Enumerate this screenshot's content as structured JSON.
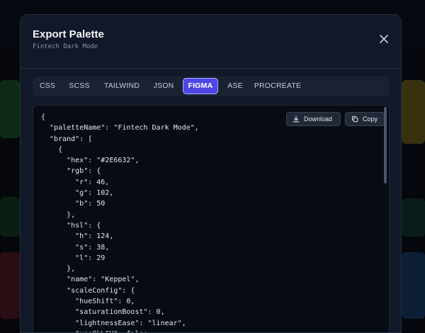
{
  "modal": {
    "title": "Export Palette",
    "subtitle": "Fintech Dark Mode"
  },
  "tabs": [
    {
      "label": "CSS",
      "active": false
    },
    {
      "label": "SCSS",
      "active": false
    },
    {
      "label": "TAILWIND",
      "active": false
    },
    {
      "label": "JSON",
      "active": false
    },
    {
      "label": "FIGMA",
      "active": true
    },
    {
      "label": "ASE",
      "active": false
    },
    {
      "label": "PROCREATE",
      "active": false
    }
  ],
  "actions": {
    "download_label": "Download",
    "copy_label": "Copy"
  },
  "code": {
    "lines": [
      "{",
      "  \"paletteName\": \"Fintech Dark Mode\",",
      "  \"brand\": [",
      "    {",
      "      \"hex\": \"#2E6632\",",
      "      \"rgb\": {",
      "        \"r\": 46,",
      "        \"g\": 102,",
      "        \"b\": 50",
      "      },",
      "      \"hsl\": {",
      "        \"h\": 124,",
      "        \"s\": 38,",
      "        \"l\": 29",
      "      },",
      "      \"name\": \"Keppel\",",
      "      \"scaleConfig\": {",
      "        \"hueShift\": 0,",
      "        \"saturationBoost\": 0,",
      "        \"lightnessEase\": \"linear\",",
      "        \"useOkLCH\": false"
    ]
  },
  "icons": {
    "close": "close-icon",
    "download": "download-icon",
    "copy": "copy-icon"
  },
  "colors": {
    "accent": "#4F46E5",
    "modal_bg": "#111827",
    "code_bg": "#070B14"
  }
}
